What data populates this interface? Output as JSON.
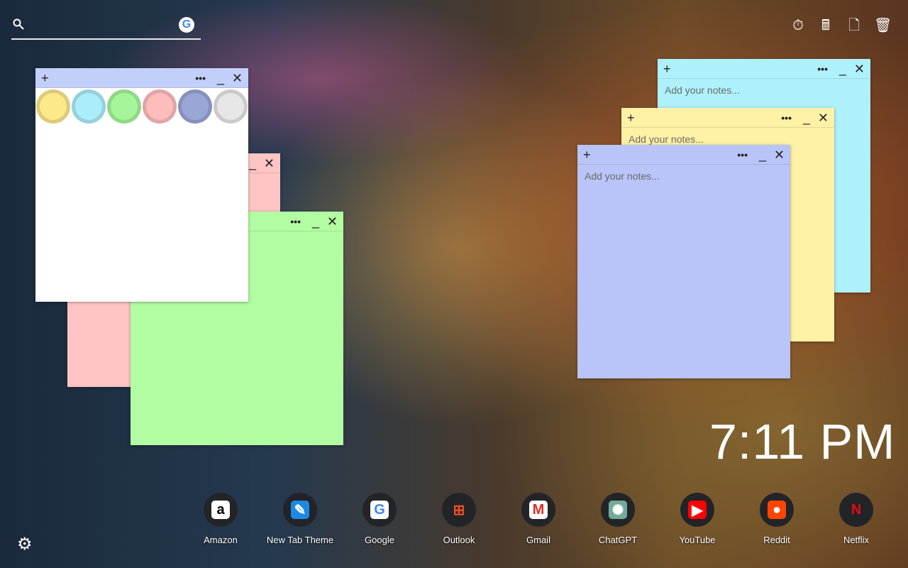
{
  "search": {
    "icon": "search-icon",
    "engine": "G"
  },
  "toolbar": [
    {
      "name": "timer-icon",
      "glyph": "⏱"
    },
    {
      "name": "calculator-icon",
      "glyph": "🖩"
    },
    {
      "name": "new-note-icon",
      "glyph": "🗋"
    },
    {
      "name": "trash-icon",
      "glyph": "🗑"
    }
  ],
  "note": {
    "plus": "+",
    "more": "•••",
    "min": "_",
    "close": "✕",
    "placeholder": "Add your notes..."
  },
  "color_picker": [
    "#fbe98a",
    "#aaeefb",
    "#a6f59a",
    "#ffbcbc",
    "#9aa6d6",
    "#e6e6e6"
  ],
  "clock": "7:11 PM",
  "apps": [
    {
      "label": "Amazon",
      "glyph": "a",
      "color": "#000",
      "bg": "#fff"
    },
    {
      "label": "New Tab Theme",
      "glyph": "✎",
      "color": "#fff",
      "bg": "#1e88e5"
    },
    {
      "label": "Google",
      "glyph": "G",
      "color": "#4285f4",
      "bg": "#fff"
    },
    {
      "label": "Outlook",
      "glyph": "⊞",
      "color": "#f25022",
      "bg": "transparent"
    },
    {
      "label": "Gmail",
      "glyph": "M",
      "color": "#d93025",
      "bg": "#fff"
    },
    {
      "label": "ChatGPT",
      "glyph": "✺",
      "color": "#fff",
      "bg": "#74aa9c"
    },
    {
      "label": "YouTube",
      "glyph": "▶",
      "color": "#fff",
      "bg": "#f00"
    },
    {
      "label": "Reddit",
      "glyph": "●",
      "color": "#fff",
      "bg": "#ff4500"
    },
    {
      "label": "Netflix",
      "glyph": "N",
      "color": "#e50914",
      "bg": "transparent"
    }
  ],
  "settings": "gear-icon"
}
